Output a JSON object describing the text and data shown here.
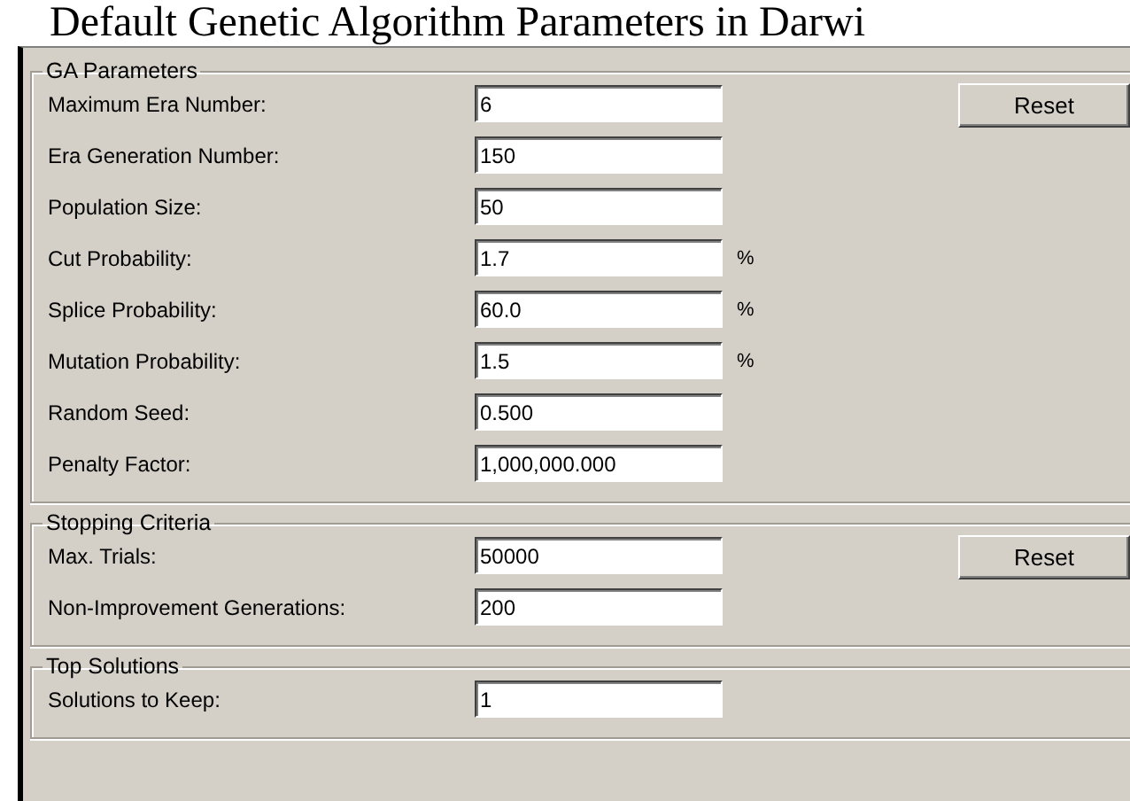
{
  "title": "Default Genetic Algorithm Parameters in Darwi",
  "groups": [
    {
      "title": "GA Parameters",
      "button": "Reset",
      "fields": [
        {
          "label": "Maximum Era Number:",
          "value": "6"
        },
        {
          "label": "Era Generation Number:",
          "value": "150"
        },
        {
          "label": "Population Size:",
          "value": "50"
        },
        {
          "label": "Cut Probability:",
          "value": "1.7",
          "unit": "%"
        },
        {
          "label": "Splice Probability:",
          "value": "60.0",
          "unit": "%"
        },
        {
          "label": "Mutation Probability:",
          "value": "1.5",
          "unit": "%"
        },
        {
          "label": "Random Seed:",
          "value": "0.500"
        },
        {
          "label": "Penalty Factor:",
          "value": "1,000,000.000"
        }
      ]
    },
    {
      "title": "Stopping Criteria",
      "button": "Reset",
      "fields": [
        {
          "label": "Max. Trials:",
          "value": "50000"
        },
        {
          "label": "Non-Improvement Generations:",
          "value": "200"
        }
      ]
    },
    {
      "title": "Top Solutions",
      "fields": [
        {
          "label": "Solutions to Keep:",
          "value": "1"
        }
      ]
    }
  ]
}
